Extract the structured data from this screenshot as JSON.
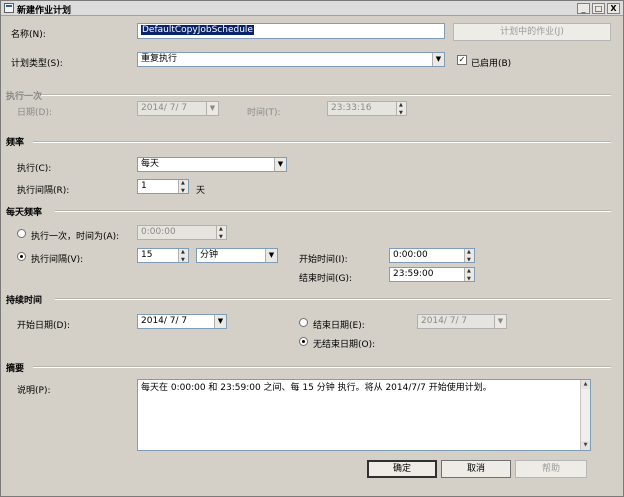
{
  "window": {
    "title": "新建作业计划",
    "min_glyph": "_",
    "max_glyph": "□",
    "close_glyph": "X"
  },
  "name": {
    "label": "名称(N):",
    "value": "DefaultCopyJobSchedule",
    "jobs_button": "计划中的作业(J)"
  },
  "schedule_type": {
    "label": "计划类型(S):",
    "value": "重复执行",
    "enabled_label": "已启用(B)",
    "enabled_checked": true,
    "check_glyph": "✓"
  },
  "one_time": {
    "heading": "执行一次",
    "date_label": "日期(D):",
    "date_value": "2014/ 7/ 7",
    "time_label": "时间(T):",
    "time_value": "23:33:16"
  },
  "frequency": {
    "heading": "频率",
    "occurs_label": "执行(C):",
    "occurs_value": "每天",
    "recurs_label": "执行间隔(R):",
    "recurs_value": "1",
    "recurs_unit": "天"
  },
  "daily": {
    "heading": "每天频率",
    "once_label": "执行一次，时间为(A):",
    "once_value": "0:00:00",
    "every_label": "执行间隔(V):",
    "every_value": "15",
    "every_unit": "分钟",
    "start_label": "开始时间(I):",
    "start_value": "0:00:00",
    "end_label": "结束时间(G):",
    "end_value": "23:59:00",
    "selected": "every"
  },
  "duration": {
    "heading": "持续时间",
    "start_date_label": "开始日期(D):",
    "start_date_value": "2014/ 7/ 7",
    "end_date_label": "结束日期(E):",
    "end_date_value": "2014/ 7/ 7",
    "no_end_label": "无结束日期(O):",
    "selected": "no_end"
  },
  "summary": {
    "heading": "摘要",
    "desc_label": "说明(P):",
    "desc_value": "每天在 0:00:00 和 23:59:00 之间、每 15 分钟 执行。将从 2014/7/7 开始使用计划。"
  },
  "buttons": {
    "ok": "确定",
    "cancel": "取消",
    "help": "帮助"
  },
  "icons": {
    "dropdown": "▼"
  }
}
